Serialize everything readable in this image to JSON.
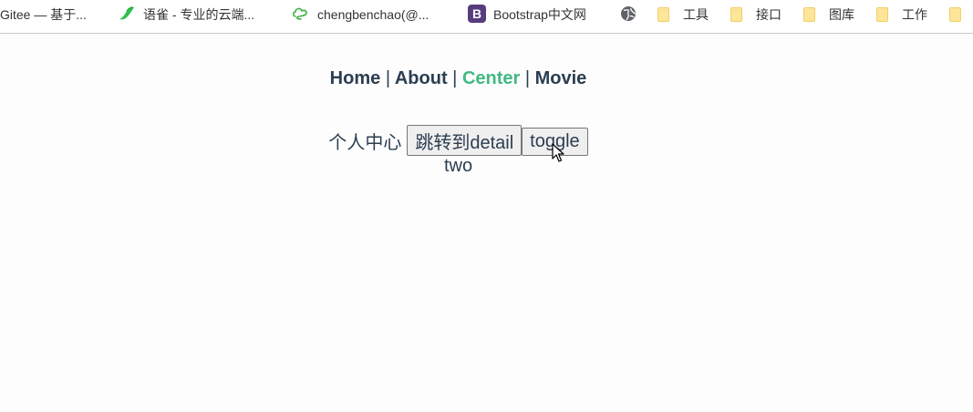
{
  "bookmarks": [
    {
      "label": "Gitee — 基于...",
      "icon": "none"
    },
    {
      "label": "语雀 - 专业的云端...",
      "icon": "yuque-bird-icon"
    },
    {
      "label": "chengbenchao(@...",
      "icon": "cloud-logo-icon"
    },
    {
      "label": "Bootstrap中文网",
      "icon": "bootstrap-icon"
    },
    {
      "label": "",
      "icon": "globe-icon"
    },
    {
      "label": "工具",
      "icon": "folder-icon"
    },
    {
      "label": "接口",
      "icon": "folder-icon"
    },
    {
      "label": "图库",
      "icon": "folder-icon"
    },
    {
      "label": "工作",
      "icon": "folder-icon"
    },
    {
      "label": "",
      "icon": "folder-icon"
    }
  ],
  "nav": {
    "home": "Home",
    "about": "About",
    "center": "Center",
    "movie": "Movie",
    "separator": "|",
    "active": "Center"
  },
  "page": {
    "title": "个人中心",
    "detail_button": "跳转到detail",
    "toggle_button": "toggle",
    "content": "two"
  },
  "colors": {
    "text": "#2c3e50",
    "active_link": "#42b983",
    "bootstrap_purple": "#563d7c",
    "yuque_green": "#2fbf4f",
    "folder_yellow": "#fde59a"
  }
}
